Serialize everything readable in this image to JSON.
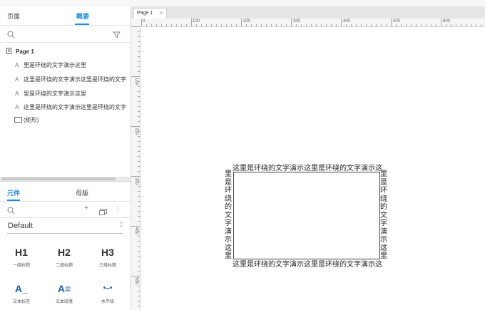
{
  "sidebar": {
    "tabs": [
      {
        "label": "页面"
      },
      {
        "label": "概要"
      }
    ],
    "outline": {
      "page_title": "Page 1",
      "items": [
        {
          "label": "里是环绕的文字演示这里"
        },
        {
          "label": "这里是环绕的文字演示这里是环绕的文字"
        },
        {
          "label": "里是环绕的文字演示这里"
        },
        {
          "label": "这里是环绕的文字演示这里是环绕的文字"
        },
        {
          "label": "(矩形)"
        }
      ]
    }
  },
  "library": {
    "tabs": [
      {
        "label": "元件"
      },
      {
        "label": "母版"
      }
    ],
    "selected_library": "Default",
    "widgets": [
      {
        "icon": "H1",
        "label": "一级标题"
      },
      {
        "icon": "H2",
        "label": "二级标题"
      },
      {
        "icon": "H3",
        "label": "三级标题"
      },
      {
        "icon": "A_",
        "label": "文本标签"
      },
      {
        "icon": "A≡",
        "label": "文本段落"
      },
      {
        "icon": "•–•",
        "label": "水平线"
      }
    ]
  },
  "canvas": {
    "tab_label": "Page 1",
    "hruler_marks": [
      "0",
      "100",
      "200",
      "300",
      "400",
      "500",
      "600"
    ],
    "vruler_marks": [
      "100",
      "200",
      "300",
      "400",
      "500"
    ],
    "shape": {
      "top_text": "这里是环绕的文字演示这里是环绕的文字演示这",
      "bottom_text": "这里是环绕的文字演示这里是环绕的文字演示这",
      "left_text": "里是环绕的文字演示这里",
      "right_text": "里是环绕的文字演示这里"
    }
  },
  "colors": {
    "accent": "#1a8dd9"
  }
}
